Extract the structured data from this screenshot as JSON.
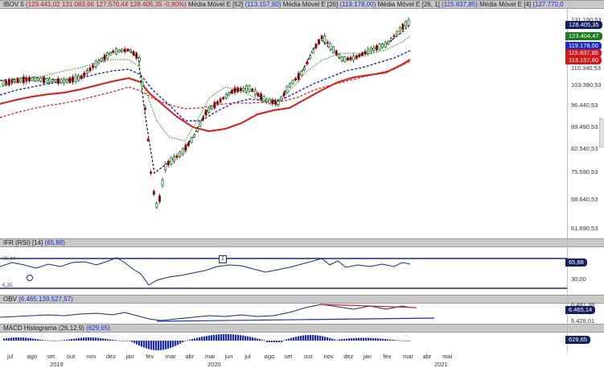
{
  "main": {
    "symbol": "IBOV 5",
    "ohlc": "(129.441,02  131.083,66  127.576,44  128.405,35  -0,80%)",
    "ma1_label": "Média Móvel E [52]",
    "ma1_val": "(113.157,60)",
    "ma2_label": "Média Móvel E [26]",
    "ma2_val": "(119.178,00)",
    "ma3_label": "Média Móvel E [26, 1]",
    "ma3_val": "(115.837,85)",
    "ma4_label": "Média Móvel E [4]",
    "ma4_val": "(127.770,0",
    "ticks": [
      "131.190,53",
      "110.340,53",
      "103.390,53",
      "96.440,53",
      "89.490,53",
      "82.540,53",
      "75.590,53",
      "68.640,53",
      "61.690,53"
    ],
    "tags": [
      "128.405,35",
      "123.404,47",
      "119.178,00",
      "115.837,85",
      "113.157,60"
    ]
  },
  "rsi": {
    "label": "IFR (RSI) [14]",
    "value": "(65,88)",
    "upper_label": "75,44",
    "lower_label": "6,35",
    "tick": "30,00",
    "tag": "65,88",
    "marker": "1"
  },
  "obv": {
    "label": "OBV",
    "value": "(6.465.139.527,57)",
    "ticks": [
      "6.481,38",
      "6.428,01"
    ],
    "tag": "6.465,14"
  },
  "macd": {
    "label": "MACD Histograma (26,12,9)",
    "value": "(629,65)",
    "tag": "629,65"
  },
  "xaxis": {
    "months": [
      "jul",
      "ago",
      "set",
      "out",
      "nov",
      "dez",
      "jan",
      "fev",
      "mar",
      "abr",
      "mai",
      "jun",
      "jul",
      "ago",
      "set",
      "out",
      "nov",
      "dez",
      "jan",
      "fev",
      "mar",
      "abr",
      "mai"
    ],
    "years": [
      "2019",
      "2020",
      "2021"
    ]
  },
  "colors": {
    "header_bg": "#c8c8c8",
    "candle_up": "#1e7d1e",
    "candle_down": "#d42020",
    "ma_red": "#e01818",
    "ma_blue": "#1a2ad0",
    "ma_green": "#1b8a1b",
    "line_navy": "#1a2a7a",
    "price_tag": "#102060",
    "ma_green_tag": "#1b7a1b",
    "ma_blue_tag": "#1a2ad0",
    "ma_red_tag": "#d41818"
  }
}
